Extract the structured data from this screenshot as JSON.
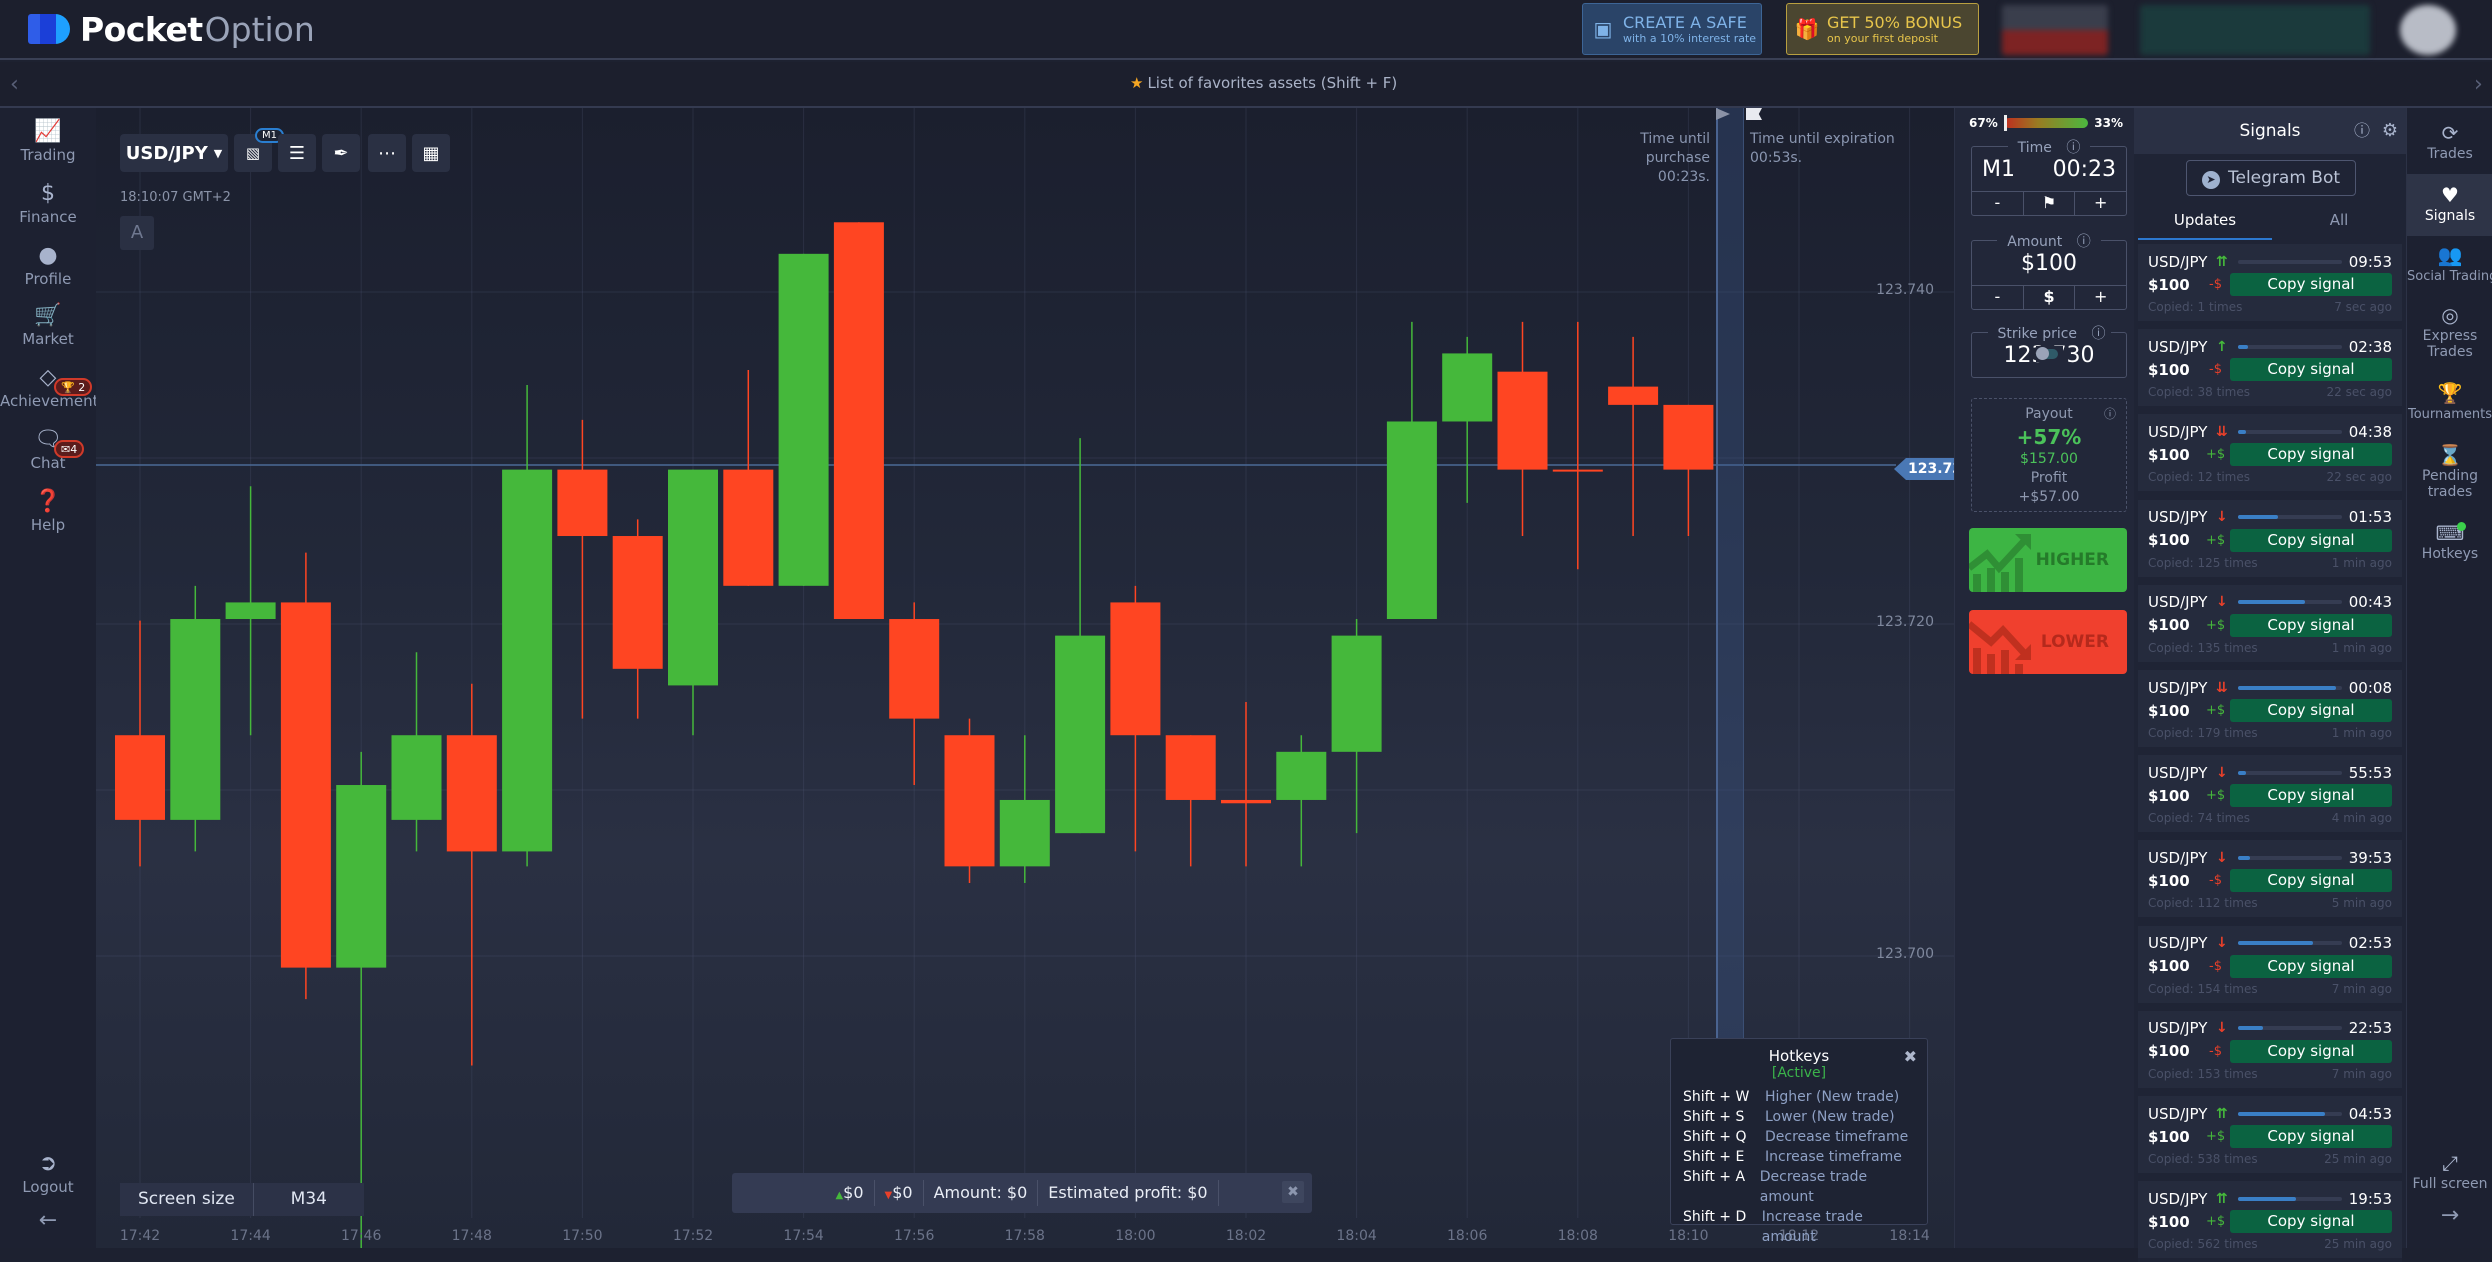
{
  "header": {
    "brand_bold": "Pocket",
    "brand_light": "Option",
    "safe_button": {
      "title": "CREATE A SAFE",
      "subtitle": "with a 10% interest rate"
    },
    "bonus_button": {
      "title": "GET 50% BONUS",
      "subtitle": "on your first deposit"
    }
  },
  "favorites_bar": {
    "label": "List of favorites assets (Shift + F)"
  },
  "left_sidebar": {
    "items": [
      {
        "label": "Trading",
        "icon": "chart-line-icon"
      },
      {
        "label": "Finance",
        "icon": "dollar-icon"
      },
      {
        "label": "Profile",
        "icon": "user-icon"
      },
      {
        "label": "Market",
        "icon": "cart-icon"
      },
      {
        "label": "Achievements",
        "icon": "diamond-icon",
        "badge": "2"
      },
      {
        "label": "Chat",
        "icon": "chat-icon",
        "badge": "4"
      },
      {
        "label": "Help",
        "icon": "help-icon"
      }
    ],
    "logout_label": "Logout"
  },
  "chart_toolbar": {
    "asset": "USD/JPY",
    "timeframe_badge": "M1",
    "clock": "18:10:07 GMT+2",
    "a_button": "A"
  },
  "timers": {
    "purchase_label": "Time until purchase",
    "purchase_value": "00:23s.",
    "expiration_label": "Time until expiration",
    "expiration_value": "00:53s."
  },
  "screen_size": {
    "label": "Screen size",
    "value": "M34"
  },
  "trade_summary": {
    "up_value": "$0",
    "down_value": "$0",
    "amount": "Amount: $0",
    "estimated_profit": "Estimated profit: $0"
  },
  "hotkeys": {
    "title": "Hotkeys",
    "status": "[Active]",
    "rows": [
      {
        "key": "Shift + W",
        "desc": "Higher (New trade)"
      },
      {
        "key": "Shift + S",
        "desc": "Lower (New trade)"
      },
      {
        "key": "Shift + Q",
        "desc": "Decrease timeframe"
      },
      {
        "key": "Shift + E",
        "desc": "Increase timeframe"
      },
      {
        "key": "Shift + A",
        "desc": "Decrease trade amount"
      },
      {
        "key": "Shift + D",
        "desc": "Increase trade amount"
      }
    ]
  },
  "trade_panel": {
    "sentiment_sell": "67%",
    "sentiment_buy": "33%",
    "sentiment_sell_fraction": 0.67,
    "time_label": "Time",
    "timeframe": "M1",
    "time_value": "00:23",
    "amount_label": "Amount",
    "amount_value": "$100",
    "amount_currency": "$",
    "minus": "-",
    "plus": "+",
    "strike_label": "Strike price",
    "strike_value": "123.730",
    "payout_label": "Payout",
    "payout_percent": "+57%",
    "payout_amount": "$157.00",
    "profit_label": "Profit",
    "profit_value": "+$57.00",
    "higher_label": "HIGHER",
    "lower_label": "LOWER"
  },
  "signals": {
    "title": "Signals",
    "telegram_label": "Telegram Bot",
    "tabs": [
      "Updates",
      "All"
    ],
    "copy_label": "Copy signal",
    "items": [
      {
        "pair": "USD/JPY",
        "dir": "up2",
        "progress": 0.0,
        "time": "09:53",
        "amount": "$100",
        "pl": "-$",
        "copied": "Copied: 1 times",
        "ago": "7 sec ago"
      },
      {
        "pair": "USD/JPY",
        "dir": "up",
        "progress": 0.1,
        "time": "02:38",
        "amount": "$100",
        "pl": "-$",
        "copied": "Copied: 38 times",
        "ago": "22 sec ago"
      },
      {
        "pair": "USD/JPY",
        "dir": "down2",
        "progress": 0.08,
        "time": "04:38",
        "amount": "$100",
        "pl": "+$",
        "copied": "Copied: 12 times",
        "ago": "22 sec ago"
      },
      {
        "pair": "USD/JPY",
        "dir": "down",
        "progress": 0.38,
        "time": "01:53",
        "amount": "$100",
        "pl": "+$",
        "copied": "Copied: 125 times",
        "ago": "1 min ago"
      },
      {
        "pair": "USD/JPY",
        "dir": "down",
        "progress": 0.64,
        "time": "00:43",
        "amount": "$100",
        "pl": "+$",
        "copied": "Copied: 135 times",
        "ago": "1 min ago"
      },
      {
        "pair": "USD/JPY",
        "dir": "down2",
        "progress": 0.94,
        "time": "00:08",
        "amount": "$100",
        "pl": "+$",
        "copied": "Copied: 179 times",
        "ago": "1 min ago"
      },
      {
        "pair": "USD/JPY",
        "dir": "down",
        "progress": 0.08,
        "time": "55:53",
        "amount": "$100",
        "pl": "+$",
        "copied": "Copied: 74 times",
        "ago": "4 min ago"
      },
      {
        "pair": "USD/JPY",
        "dir": "down",
        "progress": 0.12,
        "time": "39:53",
        "amount": "$100",
        "pl": "-$",
        "copied": "Copied: 112 times",
        "ago": "5 min ago"
      },
      {
        "pair": "USD/JPY",
        "dir": "down",
        "progress": 0.72,
        "time": "02:53",
        "amount": "$100",
        "pl": "-$",
        "copied": "Copied: 154 times",
        "ago": "7 min ago"
      },
      {
        "pair": "USD/JPY",
        "dir": "down",
        "progress": 0.24,
        "time": "22:53",
        "amount": "$100",
        "pl": "-$",
        "copied": "Copied: 153 times",
        "ago": "7 min ago"
      },
      {
        "pair": "USD/JPY",
        "dir": "up2",
        "progress": 0.84,
        "time": "04:53",
        "amount": "$100",
        "pl": "+$",
        "copied": "Copied: 538 times",
        "ago": "25 min ago"
      },
      {
        "pair": "USD/JPY",
        "dir": "up2",
        "progress": 0.56,
        "time": "19:53",
        "amount": "$100",
        "pl": "+$",
        "copied": "Copied: 562 times",
        "ago": "25 min ago"
      }
    ]
  },
  "right_sidebar": {
    "items": [
      {
        "label": "Trades",
        "icon": "history-icon"
      },
      {
        "label": "Signals",
        "icon": "heart-pulse-icon",
        "active": true
      },
      {
        "label": "Social Trading",
        "icon": "users-icon"
      },
      {
        "label": "Express Trades",
        "icon": "target-icon"
      },
      {
        "label": "Tournaments",
        "icon": "trophy-icon"
      },
      {
        "label": "Pending trades",
        "icon": "hourglass-icon"
      },
      {
        "label": "Hotkeys",
        "icon": "keyboard-icon"
      }
    ],
    "fullscreen_label": "Full screen"
  },
  "colors": {
    "up": "#45b83b",
    "down": "#ff4522",
    "accent": "#2c78cf",
    "copy_button": "#0b6341"
  },
  "chart_data": {
    "type": "candlestick",
    "title": "USD/JPY",
    "timeframe": "M1",
    "current_price": 123.73,
    "ylim": [
      123.695,
      123.748
    ],
    "yticks": [
      "123.740",
      "123.720",
      "123.700"
    ],
    "xticks": [
      "17:42",
      "17:44",
      "17:46",
      "17:48",
      "17:50",
      "17:52",
      "17:54",
      "17:56",
      "17:58",
      "18:00",
      "18:02",
      "18:04",
      "18:06",
      "18:08",
      "18:10",
      "18:12",
      "18:14"
    ],
    "grid": true,
    "candles": [
      {
        "t": "17:42",
        "o": 123.7133,
        "h": 123.7202,
        "l": 123.7054,
        "c": 123.7082
      },
      {
        "t": "17:43",
        "o": 123.7082,
        "h": 123.7223,
        "l": 123.7063,
        "c": 123.7203
      },
      {
        "t": "17:44",
        "o": 123.7203,
        "h": 123.7283,
        "l": 123.7133,
        "c": 123.7213
      },
      {
        "t": "17:45",
        "o": 123.7213,
        "h": 123.7243,
        "l": 123.6974,
        "c": 123.6993
      },
      {
        "t": "17:46",
        "o": 123.6993,
        "h": 123.7123,
        "l": 123.6824,
        "c": 123.7103
      },
      {
        "t": "17:47",
        "o": 123.7082,
        "h": 123.7183,
        "l": 123.7063,
        "c": 123.7133
      },
      {
        "t": "17:48",
        "o": 123.7133,
        "h": 123.7164,
        "l": 123.6934,
        "c": 123.7063
      },
      {
        "t": "17:49",
        "o": 123.7063,
        "h": 123.7344,
        "l": 123.7054,
        "c": 123.7293
      },
      {
        "t": "17:50",
        "o": 123.7293,
        "h": 123.7323,
        "l": 123.7143,
        "c": 123.7253
      },
      {
        "t": "17:51",
        "o": 123.7253,
        "h": 123.7263,
        "l": 123.7143,
        "c": 123.7173
      },
      {
        "t": "17:52",
        "o": 123.7163,
        "h": 123.7293,
        "l": 123.7133,
        "c": 123.7293
      },
      {
        "t": "17:53",
        "o": 123.7293,
        "h": 123.7353,
        "l": 123.7223,
        "c": 123.7223
      },
      {
        "t": "17:54",
        "o": 123.7223,
        "h": 123.7423,
        "l": 123.7223,
        "c": 123.7423
      },
      {
        "t": "17:55",
        "o": 123.7442,
        "h": 123.7442,
        "l": 123.7203,
        "c": 123.7203
      },
      {
        "t": "17:56",
        "o": 123.7203,
        "h": 123.7213,
        "l": 123.7103,
        "c": 123.7143
      },
      {
        "t": "17:57",
        "o": 123.7133,
        "h": 123.7143,
        "l": 123.7044,
        "c": 123.7054
      },
      {
        "t": "17:58",
        "o": 123.7054,
        "h": 123.7133,
        "l": 123.7044,
        "c": 123.7094
      },
      {
        "t": "17:59",
        "o": 123.7074,
        "h": 123.7312,
        "l": 123.7074,
        "c": 123.7193
      },
      {
        "t": "18:00",
        "o": 123.7213,
        "h": 123.7223,
        "l": 123.7063,
        "c": 123.7133
      },
      {
        "t": "18:01",
        "o": 123.7133,
        "h": 123.7133,
        "l": 123.7054,
        "c": 123.7094
      },
      {
        "t": "18:02",
        "o": 123.7094,
        "h": 123.7153,
        "l": 123.7054,
        "c": 123.7092
      },
      {
        "t": "18:03",
        "o": 123.7094,
        "h": 123.7133,
        "l": 123.7054,
        "c": 123.7123
      },
      {
        "t": "18:04",
        "o": 123.7123,
        "h": 123.7203,
        "l": 123.7074,
        "c": 123.7193
      },
      {
        "t": "18:05",
        "o": 123.7203,
        "h": 123.7382,
        "l": 123.7203,
        "c": 123.7322
      },
      {
        "t": "18:06",
        "o": 123.7322,
        "h": 123.7373,
        "l": 123.7273,
        "c": 123.7363
      },
      {
        "t": "18:07",
        "o": 123.7352,
        "h": 123.7382,
        "l": 123.7253,
        "c": 123.7293
      },
      {
        "t": "18:08",
        "o": 123.7293,
        "h": 123.7382,
        "l": 123.7233,
        "c": 123.7292
      },
      {
        "t": "18:09",
        "o": 123.7343,
        "h": 123.7373,
        "l": 123.7253,
        "c": 123.7332
      },
      {
        "t": "18:10",
        "o": 123.7332,
        "h": 123.7332,
        "l": 123.7253,
        "c": 123.7293
      }
    ]
  }
}
